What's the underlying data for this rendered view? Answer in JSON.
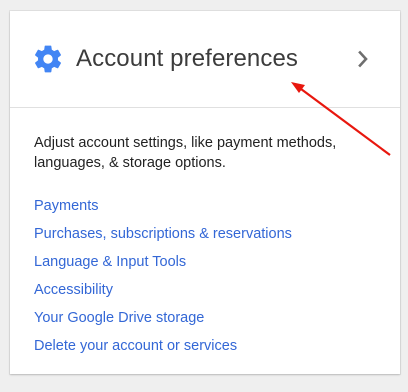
{
  "card": {
    "title": "Account preferences",
    "icon": "gear-icon",
    "expand_icon": "chevron-right-icon",
    "description": "Adjust account settings, like payment methods, languages, & storage options.",
    "links": [
      {
        "label": "Payments"
      },
      {
        "label": "Purchases, subscriptions & reservations"
      },
      {
        "label": "Language & Input Tools"
      },
      {
        "label": "Accessibility"
      },
      {
        "label": "Your Google Drive storage"
      },
      {
        "label": "Delete your account or services"
      }
    ]
  },
  "colors": {
    "icon_blue": "#4285f4",
    "link_blue": "#3367d6",
    "annotation_red": "#e8170e"
  }
}
